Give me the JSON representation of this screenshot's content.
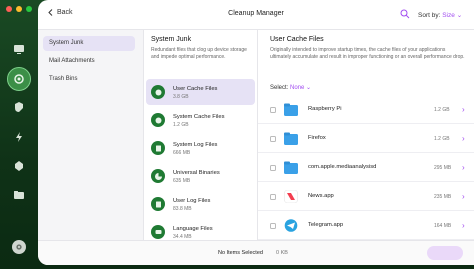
{
  "window": {
    "title": "Cleanup Manager",
    "back_label": "Back"
  },
  "sort": {
    "label": "Sort by:",
    "value": "Size"
  },
  "colors": {
    "accent": "#a14cf0",
    "app_green": "#1f7a33",
    "folder_blue": "#3aa0e8"
  },
  "categories": [
    {
      "label": "System Junk",
      "selected": true
    },
    {
      "label": "Mail Attachments",
      "selected": false
    },
    {
      "label": "Trash Bins",
      "selected": false
    }
  ],
  "middle": {
    "title": "System Junk",
    "description": "Redundant files that clog up device storage and impede optimal performance.",
    "items": [
      {
        "name": "User Cache Files",
        "size": "3.8 GB",
        "selected": true
      },
      {
        "name": "System Cache Files",
        "size": "1.2 GB",
        "selected": false
      },
      {
        "name": "System Log Files",
        "size": "666 MB",
        "selected": false
      },
      {
        "name": "Universal Binaries",
        "size": "635 MB",
        "selected": false
      },
      {
        "name": "User Log Files",
        "size": "83.8 MB",
        "selected": false
      },
      {
        "name": "Language Files",
        "size": "34.4 MB",
        "selected": false
      }
    ]
  },
  "right": {
    "title": "User Cache Files",
    "description": "Originally intended to improve startup times, the cache files of your applications ultimately accumulate and result in improper functioning or an overall performance drop.",
    "select_label": "Select:",
    "select_value": "None",
    "rows": [
      {
        "name": "Raspberry Pi",
        "size": "1.2 GB",
        "icon": "folder-icon"
      },
      {
        "name": "Firefox",
        "size": "1.2 GB",
        "icon": "folder-icon"
      },
      {
        "name": "com.apple.mediaanalysisd",
        "size": "295 MB",
        "icon": "folder-icon"
      },
      {
        "name": "News.app",
        "size": "235 MB",
        "icon": "news-app-icon"
      },
      {
        "name": "Telegram.app",
        "size": "164 MB",
        "icon": "telegram-app-icon"
      }
    ]
  },
  "footer": {
    "status": "No Items Selected",
    "size": "0 KB"
  }
}
